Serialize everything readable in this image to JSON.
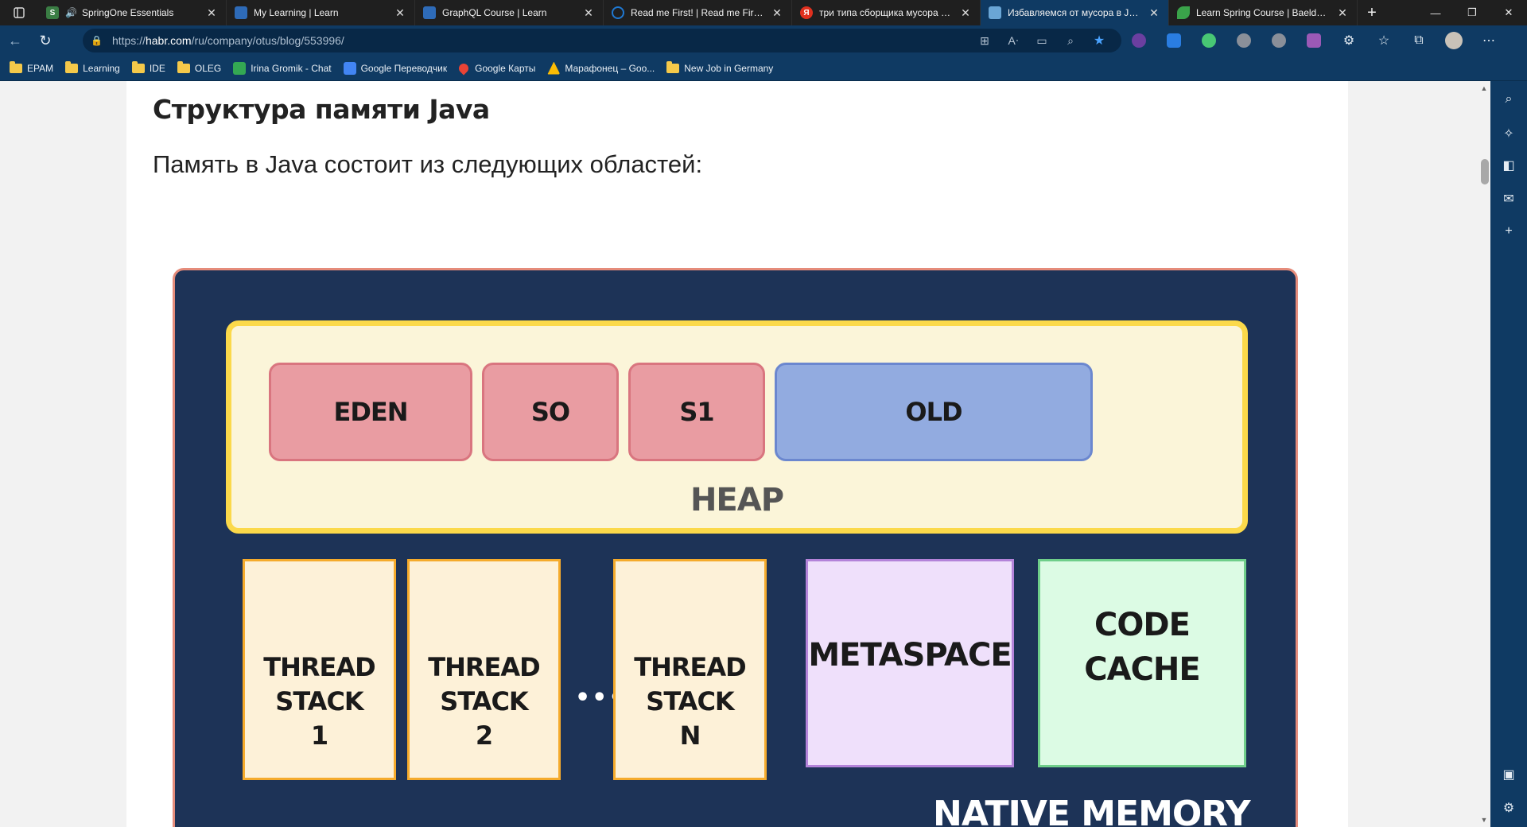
{
  "browser": {
    "tabs": [
      {
        "title": "SpringOne Essentials",
        "favicon_color": "#3a7d44",
        "favicon_letter": "S",
        "audio": true,
        "active": false
      },
      {
        "title": "My Learning | Learn",
        "favicon_color": "#2e6bb8",
        "favicon_letter": "",
        "audio": false,
        "active": false
      },
      {
        "title": "GraphQL Course | Learn",
        "favicon_color": "#2e6bb8",
        "favicon_letter": "",
        "audio": false,
        "active": false
      },
      {
        "title": "Read me First! | Read me First! | A",
        "favicon_color": "#1f78d1",
        "favicon_letter": "O",
        "audio": false,
        "active": false
      },
      {
        "title": "три типа сборщика мусора в Ja",
        "favicon_color": "#e0301e",
        "favicon_letter": "Я",
        "audio": false,
        "active": false
      },
      {
        "title": "Избавляемся от мусора в Java",
        "favicon_color": "#6aa6d6",
        "favicon_letter": "",
        "audio": false,
        "active": true
      },
      {
        "title": "Learn Spring Course | Baeldung",
        "favicon_color": "#3aa34a",
        "favicon_letter": "",
        "audio": false,
        "active": false
      }
    ],
    "new_tab_symbol": "+",
    "window_controls": [
      "—",
      "❐",
      "✕"
    ],
    "url_prefix": "https://",
    "url_host": "habr.com",
    "url_path": "/ru/company/otus/blog/553996/",
    "extension_colors": [
      "#6b3fa0",
      "#2a7de1",
      "#48c774",
      "#8a8f99",
      "#8a8f99",
      "#9b59b6"
    ],
    "bookmarks": [
      {
        "label": "EPAM",
        "type": "folder"
      },
      {
        "label": "Learning",
        "type": "folder"
      },
      {
        "label": "IDE",
        "type": "folder"
      },
      {
        "label": "OLEG",
        "type": "folder"
      },
      {
        "label": "Irina Gromik - Chat",
        "type": "link",
        "icon_color": "#34a853"
      },
      {
        "label": "Google Переводчик",
        "type": "link",
        "icon_color": "#4285f4"
      },
      {
        "label": "Google Карты",
        "type": "link",
        "icon_color": "#ea4335"
      },
      {
        "label": "Марафонец – Goo...",
        "type": "link",
        "icon_color": "#fbbc05"
      },
      {
        "label": "New Job in Germany",
        "type": "folder"
      }
    ]
  },
  "article": {
    "heading": "Структура памяти Java",
    "paragraph": "Память в Java состоит из следующих областей:"
  },
  "diagram": {
    "generations": [
      {
        "label": "EDEN",
        "kind": "young"
      },
      {
        "label": "SO",
        "kind": "young"
      },
      {
        "label": "S1",
        "kind": "young"
      },
      {
        "label": "OLD",
        "kind": "old"
      }
    ],
    "heap_label": "HEAP",
    "stacks": [
      {
        "line1": "THREAD",
        "line2": "STACK",
        "line3": "1"
      },
      {
        "line1": "THREAD",
        "line2": "STACK",
        "line3": "2"
      },
      {
        "line1": "THREAD",
        "line2": "STACK",
        "line3": "N"
      }
    ],
    "ellipsis": "•••",
    "metaspace": "METASPACE",
    "code_cache_line1": "CODE",
    "code_cache_line2": "CACHE",
    "native_memory": "NATIVE MEMORY",
    "colors": {
      "background": "#1d3357",
      "frame_border": "#e58c7b",
      "heap_fill": "#fbf5d9",
      "heap_border": "#fbd94a",
      "young_fill": "#e99ca2",
      "old_fill": "#92abe0",
      "stack_fill": "#fdf1d8",
      "stack_border": "#f5ab2c",
      "metaspace_fill": "#efe0fb",
      "code_cache_fill": "#dcfbe4"
    }
  }
}
